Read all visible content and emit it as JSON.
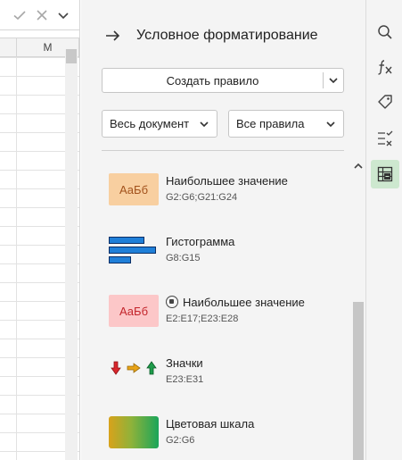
{
  "sheet": {
    "column_label": "M",
    "confirm_icon": "check-icon",
    "cancel_icon": "close-icon",
    "more_icon": "chevron-down-icon"
  },
  "panel": {
    "title": "Условное форматирование",
    "back_icon": "arrow-right-icon",
    "create_button": "Создать правило",
    "scope_dropdown": "Весь документ",
    "rules_dropdown": "Все правила"
  },
  "rules": [
    {
      "preview_text": "АаБб",
      "name": "Наибольшее  значение",
      "range": "G2:G6;G21:G24",
      "preview": "orange-text"
    },
    {
      "preview_text": "",
      "name": "Гистограмма",
      "range": "G8:G15",
      "preview": "data-bars"
    },
    {
      "preview_text": "АаБб",
      "name": "Наибольшее  значение",
      "range": "E2:E17;E23:E28",
      "preview": "pink-text",
      "stop_icon": "stop-if-true-icon"
    },
    {
      "preview_text": "",
      "name": "Значки",
      "range": "E23:E31",
      "preview": "icon-set"
    },
    {
      "preview_text": "",
      "name": "Цветовая шкала",
      "range": "G2:G6",
      "preview": "color-scale"
    }
  ],
  "rail": [
    {
      "icon": "search-icon"
    },
    {
      "icon": "function-icon"
    },
    {
      "icon": "tag-icon"
    },
    {
      "icon": "checklist-icon"
    },
    {
      "icon": "conditional-formatting-icon",
      "active": true
    }
  ],
  "colors": {
    "accent_active": "#cde8cf",
    "bar_fill": "#1f7fd8",
    "orange_bg": "#f8cfa0",
    "pink_bg": "#fcc7c8"
  }
}
